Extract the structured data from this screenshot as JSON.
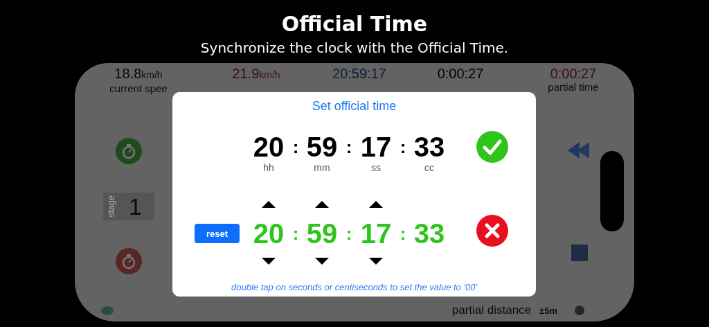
{
  "header": {
    "title": "Official Time",
    "subtitle": "Synchronize the clock with the Official Time."
  },
  "stats": [
    {
      "value": "18.8",
      "unit": "km/h",
      "label": "current spee",
      "color": "#0a0a0a"
    },
    {
      "value": "21.9",
      "unit": "km/h",
      "color": "#3d0c0f"
    },
    {
      "value": "20:59:17",
      "color": "#0e1c3a"
    },
    {
      "value": "0:00:27",
      "color": "#000000"
    },
    {
      "value": "0:00:27",
      "label": "partial time",
      "color": "#3d0c0f"
    }
  ],
  "stage": {
    "label": "stage",
    "value": "1"
  },
  "distance": {
    "label": "partial distance",
    "accuracy": "±5m"
  },
  "dialog": {
    "title": "Set official time",
    "separator": ":",
    "current": [
      {
        "value": "20",
        "unit": "hh"
      },
      {
        "value": "59",
        "unit": "mm"
      },
      {
        "value": "17",
        "unit": "ss"
      },
      {
        "value": "33",
        "unit": "cc"
      }
    ],
    "new": [
      {
        "value": "20",
        "adjustable": true
      },
      {
        "value": "59",
        "adjustable": true
      },
      {
        "value": "17",
        "adjustable": true
      },
      {
        "value": "33",
        "adjustable": false
      }
    ],
    "reset": "reset",
    "hint": "double tap on seconds or centiseconds to set the value to '00'"
  }
}
